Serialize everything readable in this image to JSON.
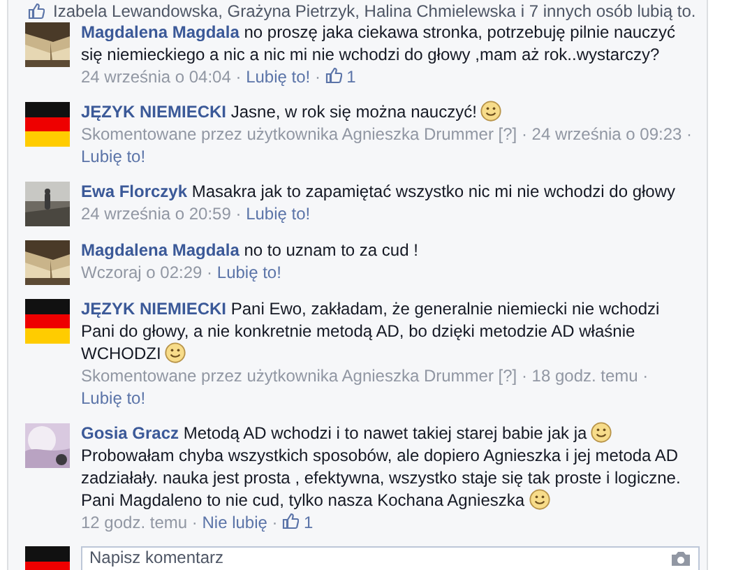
{
  "likes_summary": {
    "text": "Izabela Lewandowska, Grażyna Pietrzyk, Halina Chmielewska i 7 innych osób lubią to."
  },
  "comments": [
    {
      "author": "Magdalena Magdala",
      "avatar": {
        "kind": "picture"
      },
      "body": [
        {
          "kind": "text",
          "text": "no proszę jaka ciekawa stronka, potrzebuję pilnie nauczyć się niemieckiego a nic a nic mi nie wchodzi do głowy ,mam aż rok..wystarczy?"
        }
      ],
      "meta": [
        {
          "kind": "text",
          "text": "24 września o 04:04 ·"
        },
        {
          "kind": "link",
          "text": "Lubię to!"
        },
        {
          "kind": "text",
          "text": "·"
        },
        {
          "kind": "likes",
          "text": "1"
        }
      ]
    },
    {
      "author": "JĘZYK NIEMIECKI",
      "avatar": {
        "kind": "flag"
      },
      "body": [
        {
          "kind": "text",
          "text": "Jasne, w rok się można nauczyć!"
        },
        {
          "kind": "smiley"
        }
      ],
      "meta": [
        {
          "kind": "text",
          "text": "Skomentowane przez użytkownika Agnieszka Drummer [?] · 24 września o 09:23 ·"
        },
        {
          "kind": "link",
          "text": "Lubię to!"
        }
      ]
    },
    {
      "author": "Ewa Florczyk",
      "avatar": {
        "kind": "picture"
      },
      "body": [
        {
          "kind": "text",
          "text": "Masakra jak to zapamiętać wszystko nic mi nie wchodzi do głowy"
        }
      ],
      "meta": [
        {
          "kind": "text",
          "text": "24 września o 20:59 ·"
        },
        {
          "kind": "link",
          "text": "Lubię to!"
        }
      ]
    },
    {
      "author": "Magdalena Magdala",
      "avatar": {
        "kind": "picture"
      },
      "body": [
        {
          "kind": "text",
          "text": "no to uznam to za cud !"
        }
      ],
      "meta": [
        {
          "kind": "text",
          "text": "Wczoraj o 02:29 ·"
        },
        {
          "kind": "link",
          "text": "Lubię to!"
        }
      ]
    },
    {
      "author": "JĘZYK NIEMIECKI",
      "avatar": {
        "kind": "flag"
      },
      "body": [
        {
          "kind": "text",
          "text": "Pani Ewo, zakładam, że generalnie niemiecki nie wchodzi Pani do głowy, a nie konkretnie metodą AD, bo dzięki metodzie AD właśnie WCHODZI"
        },
        {
          "kind": "smiley"
        }
      ],
      "meta": [
        {
          "kind": "text",
          "text": "Skomentowane przez użytkownika Agnieszka Drummer [?] · 18 godz. temu ·"
        },
        {
          "kind": "link",
          "text": "Lubię to!"
        }
      ]
    },
    {
      "author": "Gosia Gracz",
      "avatar": {
        "kind": "picture"
      },
      "body": [
        {
          "kind": "text",
          "text": "Metodą AD wchodzi i to nawet takiej starej babie jak ja"
        },
        {
          "kind": "smiley"
        },
        {
          "kind": "text",
          "text": "Probowałam chyba wszystkich sposobów, ale dopiero Agnieszka i jej metoda AD zadziałały. nauka jest prosta , efektywna, wszystko staje się tak proste i logiczne. Pani Magdaleno to nie cud, tylko nasza Kochana Agnieszka"
        },
        {
          "kind": "smiley"
        }
      ],
      "meta": [
        {
          "kind": "text",
          "text": "12 godz. temu ·"
        },
        {
          "kind": "link",
          "text": "Nie lubię"
        },
        {
          "kind": "text",
          "text": "·"
        },
        {
          "kind": "likes",
          "text": "1"
        }
      ]
    }
  ],
  "composer": {
    "avatar": {
      "kind": "flag"
    },
    "placeholder": "Napisz komentarz"
  }
}
